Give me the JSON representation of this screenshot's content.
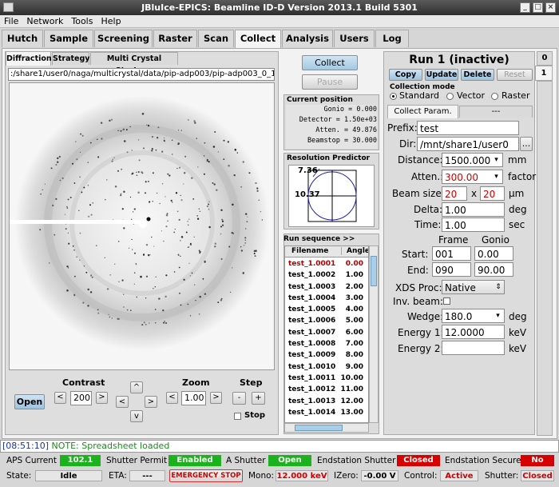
{
  "window": {
    "title": "JBluIce-EPICS: Beamline ID-D Version 2013.1 Build 5301"
  },
  "menu": [
    "File",
    "Network",
    "Tools",
    "Help"
  ],
  "tabs": [
    "Hutch",
    "Sample",
    "Screening",
    "Raster",
    "Scan",
    "Collect",
    "Analysis",
    "Users",
    "Log"
  ],
  "active_tab": "Collect",
  "subtabs": [
    "Diffraction",
    "Strategy",
    "Multi Crystal Strategy"
  ],
  "image_path": ":/share1/user0/naga/multicrystal/data/pip-adp003/pip-adp003_0_1.0",
  "image_controls": {
    "open": "Open",
    "contrast_label": "Contrast",
    "contrast_value": "200",
    "zoom_label": "Zoom",
    "zoom_value": "1.00",
    "step_label": "Step",
    "stop_label": "Stop",
    "left": "<",
    "right": ">",
    "up": "^",
    "down": "v",
    "minus": "-",
    "plus": "+"
  },
  "collect_buttons": {
    "collect": "Collect",
    "pause": "Pause"
  },
  "current_position": {
    "title": "Current position",
    "rows": [
      {
        "label": "Gonio",
        "value": "0.000"
      },
      {
        "label": "Detector",
        "value": "1.50e+03"
      },
      {
        "label": "Atten.",
        "value": "49.876"
      },
      {
        "label": "Beamstop",
        "value": "30.000"
      }
    ]
  },
  "resolution": {
    "title": "Resolution Predictor",
    "outer": "7.36",
    "inner": "10.37"
  },
  "run_sequence": {
    "title": "Run sequence >>",
    "headers": [
      "Filename",
      "Angle"
    ],
    "rows": [
      {
        "file": "test_1.0001",
        "angle": "0.00"
      },
      {
        "file": "test_1.0002",
        "angle": "1.00"
      },
      {
        "file": "test_1.0003",
        "angle": "2.00"
      },
      {
        "file": "test_1.0004",
        "angle": "3.00"
      },
      {
        "file": "test_1.0005",
        "angle": "4.00"
      },
      {
        "file": "test_1.0006",
        "angle": "5.00"
      },
      {
        "file": "test_1.0007",
        "angle": "6.00"
      },
      {
        "file": "test_1.0008",
        "angle": "7.00"
      },
      {
        "file": "test_1.0009",
        "angle": "8.00"
      },
      {
        "file": "test_1.0010",
        "angle": "9.00"
      },
      {
        "file": "test_1.0011",
        "angle": "10.00"
      },
      {
        "file": "test_1.0012",
        "angle": "11.00"
      },
      {
        "file": "test_1.0013",
        "angle": "12.00"
      },
      {
        "file": "test_1.0014",
        "angle": "13.00"
      }
    ]
  },
  "run": {
    "title": "Run 1 (inactive)",
    "buttons": [
      "Copy",
      "Update",
      "Delete",
      "Reset"
    ],
    "collection_mode_label": "Collection mode",
    "modes": [
      "Standard",
      "Vector",
      "Raster"
    ],
    "selected_mode": "Standard",
    "subtabs": [
      "Collect Param.",
      "---"
    ],
    "prefix_label": "Prefix:",
    "prefix": "test",
    "dir_label": "Dir:",
    "dir": "/mnt/share1/user0",
    "dir_button": "...",
    "distance_label": "Distance:",
    "distance": "1500.000",
    "distance_unit": "mm",
    "atten_label": "Atten.:",
    "atten": "300.00",
    "atten_unit": "factor",
    "beam_label": "Beam size:",
    "beam_w": "20",
    "beam_x": "x",
    "beam_h": "20",
    "beam_unit": "μm",
    "delta_label": "Delta:",
    "delta": "1.00",
    "delta_unit": "deg",
    "time_label": "Time:",
    "time": "1.00",
    "time_unit": "sec",
    "frame_header": "Frame",
    "gonio_header": "Gonio",
    "start_label": "Start:",
    "start_frame": "001",
    "start_gonio": "0.00",
    "end_label": "End:",
    "end_frame": "090",
    "end_gonio": "90.00",
    "xds_label": "XDS Proc:",
    "xds": "Native",
    "inv_label": "Inv. beam:",
    "wedge_label": "Wedge:",
    "wedge": "180.0",
    "wedge_unit": "deg",
    "energy1_label": "Energy 1:",
    "energy1": "12.0000",
    "energy1_unit": "keV",
    "energy2_label": "Energy 2:",
    "energy2": "",
    "energy2_unit": "keV"
  },
  "run_tabs": [
    "0",
    "1"
  ],
  "log_line": {
    "time": "[08:51:10]",
    "message": "NOTE: Spreadsheet loaded"
  },
  "status": {
    "aps_label": "APS Current",
    "aps": "102.1",
    "shutter_permit_label": "Shutter Permit",
    "shutter_permit": "Enabled",
    "a_shutter_label": "A Shutter",
    "a_shutter": "Open",
    "end_shutter_label": "Endstation Shutter",
    "end_shutter": "Closed",
    "end_secure_label": "Endstation Secure",
    "end_secure": "No",
    "state_label": "State:",
    "state": "Idle",
    "eta_label": "ETA:",
    "eta": "---",
    "emergency": "EMERGENCY STOP",
    "mono_label": "Mono:",
    "mono": "12.000 keV",
    "izero_label": "IZero:",
    "izero": "-0.00 V",
    "control_label": "Control:",
    "control": "Active",
    "shutter_label": "Shutter:",
    "shutter": "Closed"
  },
  "colors": {
    "green": "#1eb11e",
    "red": "#d60000",
    "accent": "#a9cfe8"
  }
}
